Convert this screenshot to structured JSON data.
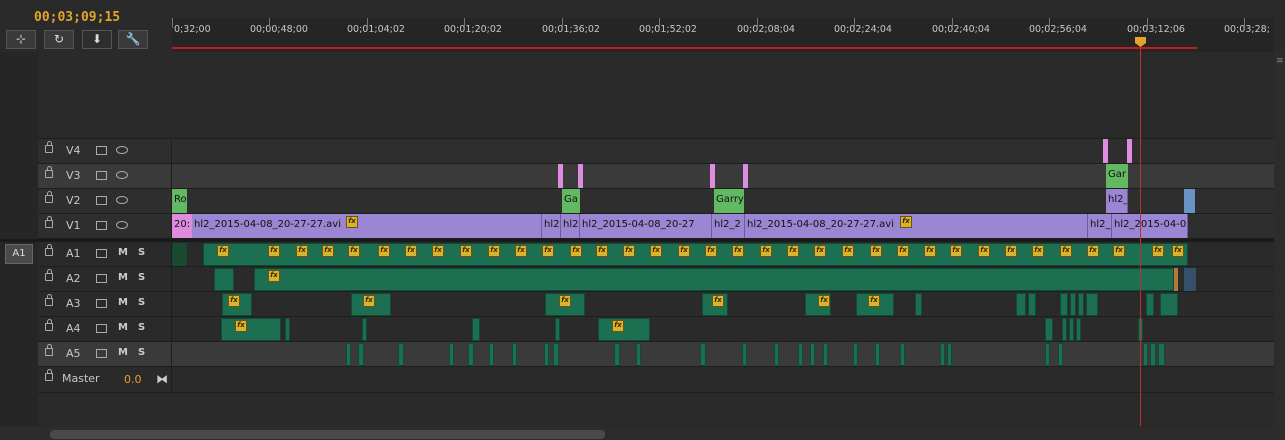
{
  "timecode": "00;03;09;15",
  "toolbar": {
    "icons": [
      "snap-icon",
      "linked-selection-icon",
      "add-marker-icon",
      "timeline-settings-icon"
    ]
  },
  "ruler": {
    "ticks": [
      "0;32;00",
      "00;00;48;00",
      "00;01;04;02",
      "00;01;20;02",
      "00;01;36;02",
      "00;01;52;02",
      "00;02;08;04",
      "00;02;24;04",
      "00;02;40;04",
      "00;02;56;04",
      "00;03;12;06",
      "00;03;28;"
    ]
  },
  "source_patch": "A1",
  "video_tracks": [
    {
      "name": "V4"
    },
    {
      "name": "V3"
    },
    {
      "name": "V2"
    },
    {
      "name": "V1"
    }
  ],
  "audio_tracks": [
    {
      "name": "A1",
      "m": "M",
      "s": "S"
    },
    {
      "name": "A2",
      "m": "M",
      "s": "S"
    },
    {
      "name": "A3",
      "m": "M",
      "s": "S"
    },
    {
      "name": "A4",
      "m": "M",
      "s": "S"
    },
    {
      "name": "A5",
      "m": "M",
      "s": "S"
    }
  ],
  "master": {
    "label": "Master",
    "value": "0.0"
  },
  "clips": {
    "v1": [
      {
        "label": "20:"
      },
      {
        "label": "hl2_2015-04-08_20-27-27.avi"
      },
      {
        "label": "hl2"
      },
      {
        "label": "hl2"
      },
      {
        "label": "hl2_2015-04-08_20-27"
      },
      {
        "label": "hl2_2"
      },
      {
        "label": "hl2_2015-04-08_20-27-27.avi"
      },
      {
        "label": "hl2_"
      },
      {
        "label": "hl2_2015-04-0"
      }
    ],
    "v2": [
      {
        "label": "Ro"
      },
      {
        "label": "Ga"
      },
      {
        "label": "Garry"
      },
      {
        "label": "hl2_"
      }
    ],
    "v3_title": {
      "label": "Gar"
    }
  },
  "colors": {
    "timecode": "#e2a42a",
    "video_clip": "#9b86d3",
    "title_clip": "#62b962",
    "pink_clip": "#dd8ce0",
    "audio_clip": "#1c6f51",
    "playhead": "#c0302a"
  }
}
